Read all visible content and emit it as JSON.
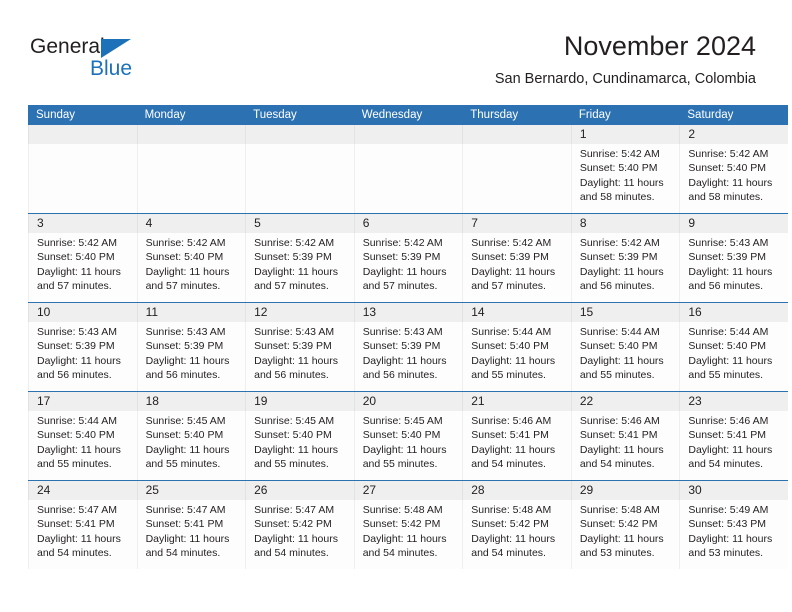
{
  "brand": {
    "name_top": "General",
    "name_bottom": "Blue",
    "accent_color": "#1c71b8",
    "triangle_icon": "triangle-icon"
  },
  "header": {
    "title": "November 2024",
    "subtitle": "San Bernardo, Cundinamarca, Colombia"
  },
  "theme": {
    "header_bar_color": "#2c72b3",
    "date_band_color": "#efefef",
    "text_color": "#231f20",
    "cell_background": "#fdfdfd"
  },
  "calendar": {
    "weekday_headers": [
      "Sunday",
      "Monday",
      "Tuesday",
      "Wednesday",
      "Thursday",
      "Friday",
      "Saturday"
    ],
    "weeks": [
      [
        {
          "day": "",
          "lines": []
        },
        {
          "day": "",
          "lines": []
        },
        {
          "day": "",
          "lines": []
        },
        {
          "day": "",
          "lines": []
        },
        {
          "day": "",
          "lines": []
        },
        {
          "day": "1",
          "lines": [
            "Sunrise: 5:42 AM",
            "Sunset: 5:40 PM",
            "Daylight: 11 hours and 58 minutes."
          ]
        },
        {
          "day": "2",
          "lines": [
            "Sunrise: 5:42 AM",
            "Sunset: 5:40 PM",
            "Daylight: 11 hours and 58 minutes."
          ]
        }
      ],
      [
        {
          "day": "3",
          "lines": [
            "Sunrise: 5:42 AM",
            "Sunset: 5:40 PM",
            "Daylight: 11 hours and 57 minutes."
          ]
        },
        {
          "day": "4",
          "lines": [
            "Sunrise: 5:42 AM",
            "Sunset: 5:40 PM",
            "Daylight: 11 hours and 57 minutes."
          ]
        },
        {
          "day": "5",
          "lines": [
            "Sunrise: 5:42 AM",
            "Sunset: 5:39 PM",
            "Daylight: 11 hours and 57 minutes."
          ]
        },
        {
          "day": "6",
          "lines": [
            "Sunrise: 5:42 AM",
            "Sunset: 5:39 PM",
            "Daylight: 11 hours and 57 minutes."
          ]
        },
        {
          "day": "7",
          "lines": [
            "Sunrise: 5:42 AM",
            "Sunset: 5:39 PM",
            "Daylight: 11 hours and 57 minutes."
          ]
        },
        {
          "day": "8",
          "lines": [
            "Sunrise: 5:42 AM",
            "Sunset: 5:39 PM",
            "Daylight: 11 hours and 56 minutes."
          ]
        },
        {
          "day": "9",
          "lines": [
            "Sunrise: 5:43 AM",
            "Sunset: 5:39 PM",
            "Daylight: 11 hours and 56 minutes."
          ]
        }
      ],
      [
        {
          "day": "10",
          "lines": [
            "Sunrise: 5:43 AM",
            "Sunset: 5:39 PM",
            "Daylight: 11 hours and 56 minutes."
          ]
        },
        {
          "day": "11",
          "lines": [
            "Sunrise: 5:43 AM",
            "Sunset: 5:39 PM",
            "Daylight: 11 hours and 56 minutes."
          ]
        },
        {
          "day": "12",
          "lines": [
            "Sunrise: 5:43 AM",
            "Sunset: 5:39 PM",
            "Daylight: 11 hours and 56 minutes."
          ]
        },
        {
          "day": "13",
          "lines": [
            "Sunrise: 5:43 AM",
            "Sunset: 5:39 PM",
            "Daylight: 11 hours and 56 minutes."
          ]
        },
        {
          "day": "14",
          "lines": [
            "Sunrise: 5:44 AM",
            "Sunset: 5:40 PM",
            "Daylight: 11 hours and 55 minutes."
          ]
        },
        {
          "day": "15",
          "lines": [
            "Sunrise: 5:44 AM",
            "Sunset: 5:40 PM",
            "Daylight: 11 hours and 55 minutes."
          ]
        },
        {
          "day": "16",
          "lines": [
            "Sunrise: 5:44 AM",
            "Sunset: 5:40 PM",
            "Daylight: 11 hours and 55 minutes."
          ]
        }
      ],
      [
        {
          "day": "17",
          "lines": [
            "Sunrise: 5:44 AM",
            "Sunset: 5:40 PM",
            "Daylight: 11 hours and 55 minutes."
          ]
        },
        {
          "day": "18",
          "lines": [
            "Sunrise: 5:45 AM",
            "Sunset: 5:40 PM",
            "Daylight: 11 hours and 55 minutes."
          ]
        },
        {
          "day": "19",
          "lines": [
            "Sunrise: 5:45 AM",
            "Sunset: 5:40 PM",
            "Daylight: 11 hours and 55 minutes."
          ]
        },
        {
          "day": "20",
          "lines": [
            "Sunrise: 5:45 AM",
            "Sunset: 5:40 PM",
            "Daylight: 11 hours and 55 minutes."
          ]
        },
        {
          "day": "21",
          "lines": [
            "Sunrise: 5:46 AM",
            "Sunset: 5:41 PM",
            "Daylight: 11 hours and 54 minutes."
          ]
        },
        {
          "day": "22",
          "lines": [
            "Sunrise: 5:46 AM",
            "Sunset: 5:41 PM",
            "Daylight: 11 hours and 54 minutes."
          ]
        },
        {
          "day": "23",
          "lines": [
            "Sunrise: 5:46 AM",
            "Sunset: 5:41 PM",
            "Daylight: 11 hours and 54 minutes."
          ]
        }
      ],
      [
        {
          "day": "24",
          "lines": [
            "Sunrise: 5:47 AM",
            "Sunset: 5:41 PM",
            "Daylight: 11 hours and 54 minutes."
          ]
        },
        {
          "day": "25",
          "lines": [
            "Sunrise: 5:47 AM",
            "Sunset: 5:41 PM",
            "Daylight: 11 hours and 54 minutes."
          ]
        },
        {
          "day": "26",
          "lines": [
            "Sunrise: 5:47 AM",
            "Sunset: 5:42 PM",
            "Daylight: 11 hours and 54 minutes."
          ]
        },
        {
          "day": "27",
          "lines": [
            "Sunrise: 5:48 AM",
            "Sunset: 5:42 PM",
            "Daylight: 11 hours and 54 minutes."
          ]
        },
        {
          "day": "28",
          "lines": [
            "Sunrise: 5:48 AM",
            "Sunset: 5:42 PM",
            "Daylight: 11 hours and 54 minutes."
          ]
        },
        {
          "day": "29",
          "lines": [
            "Sunrise: 5:48 AM",
            "Sunset: 5:42 PM",
            "Daylight: 11 hours and 53 minutes."
          ]
        },
        {
          "day": "30",
          "lines": [
            "Sunrise: 5:49 AM",
            "Sunset: 5:43 PM",
            "Daylight: 11 hours and 53 minutes."
          ]
        }
      ]
    ]
  }
}
